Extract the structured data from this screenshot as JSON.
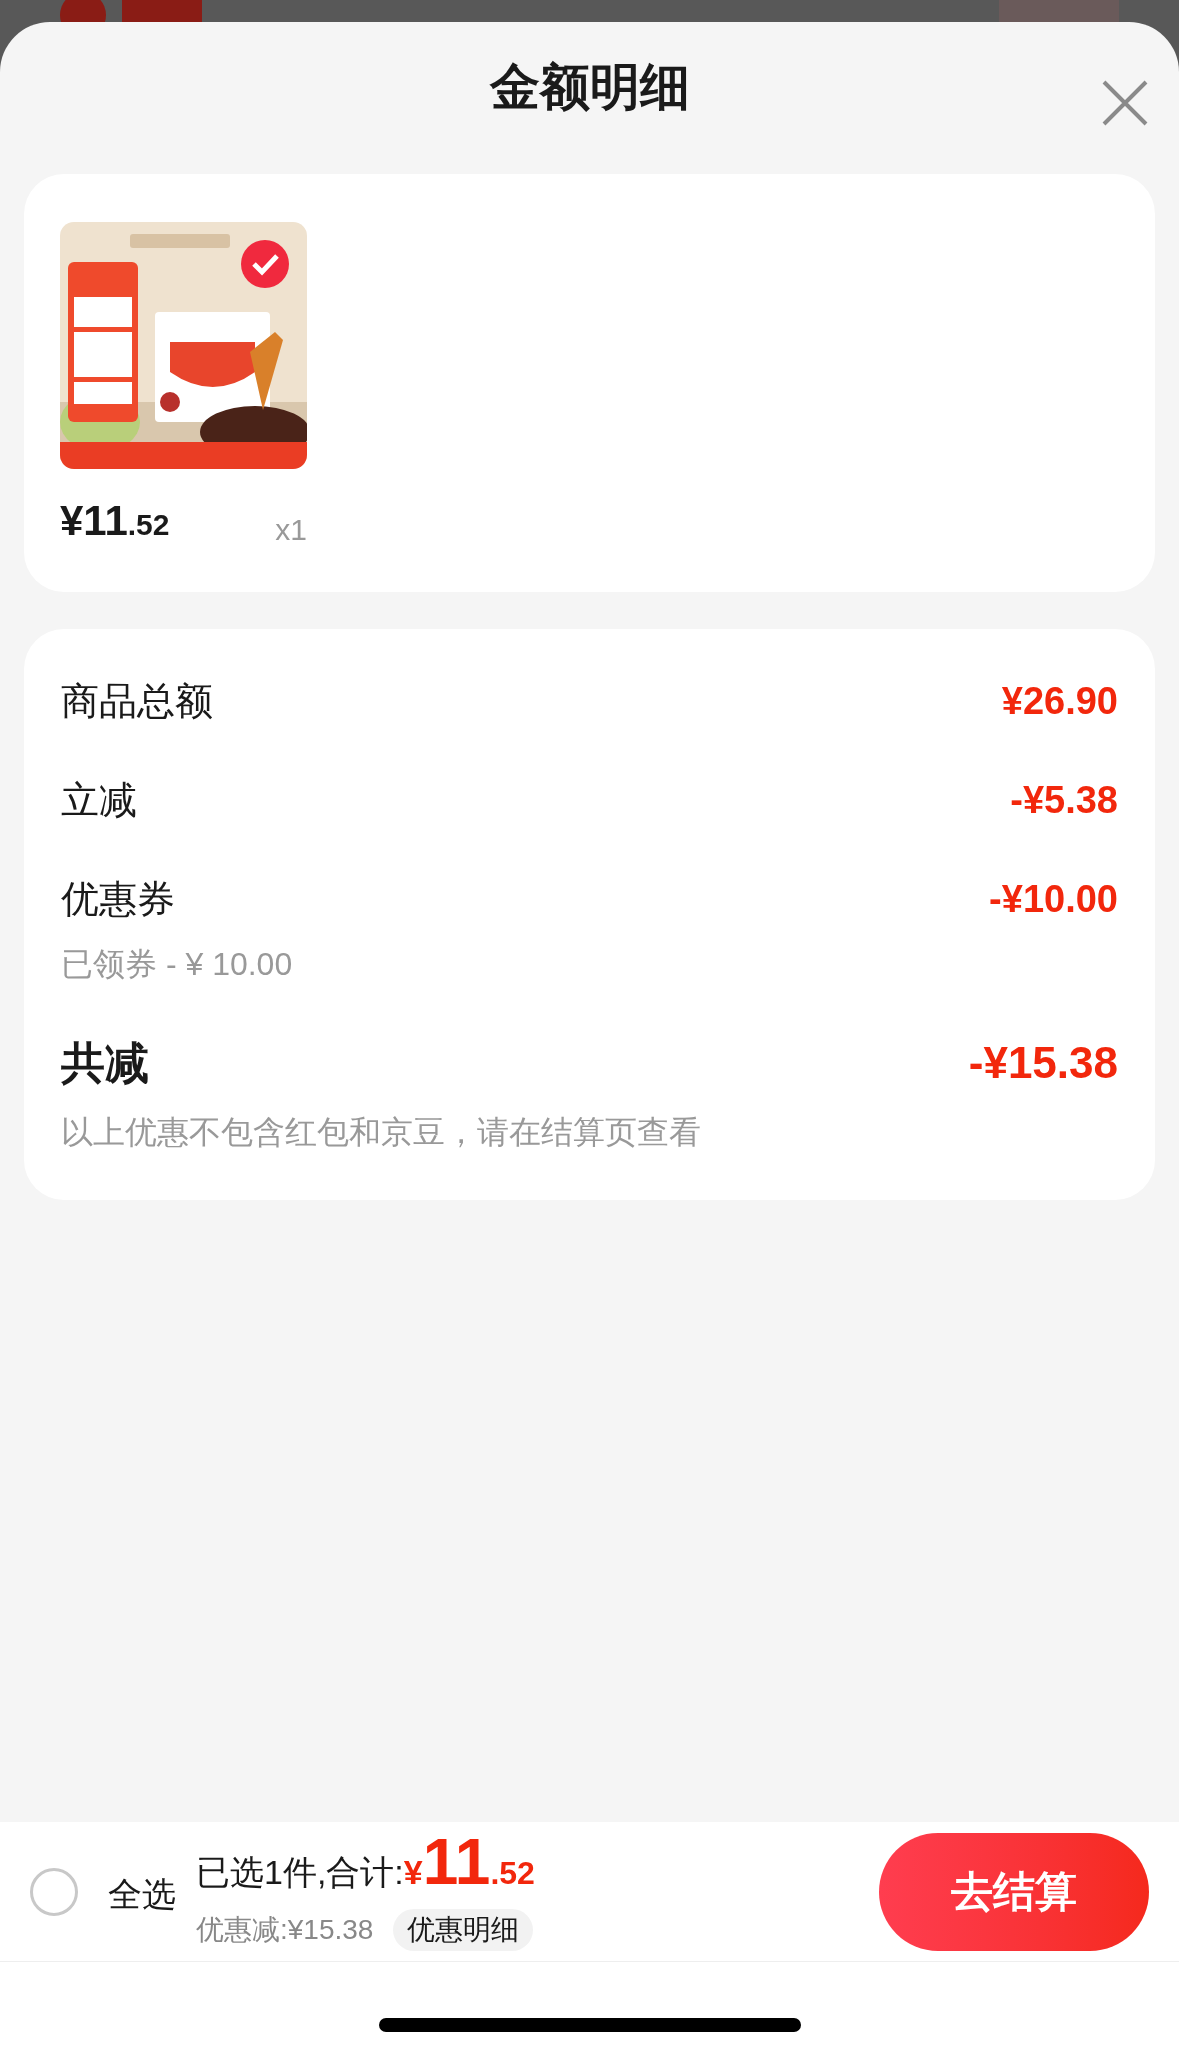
{
  "sheet": {
    "title": "金额明细"
  },
  "products": [
    {
      "kind": "picture",
      "selected": true,
      "price_symbol": "¥",
      "price_integer": "11",
      "price_decimal": ".52",
      "quantity": "x1"
    }
  ],
  "summary_rows": [
    {
      "kind": "normal",
      "label": "商品总额",
      "amount": "¥26.90"
    },
    {
      "kind": "normal",
      "label": "立减",
      "amount": "-¥5.38"
    },
    {
      "kind": "normal",
      "label": "优惠券",
      "amount": "-¥10.00",
      "note": "已领券 - ¥ 10.00"
    },
    {
      "kind": "total",
      "label": "共减",
      "amount": "-¥15.38",
      "note": "以上优惠不包含红包和京豆，请在结算页查看"
    }
  ],
  "bottom_bar": {
    "select_all": {
      "label": "全选",
      "checked": false
    },
    "selected_count": "已选1件,合计:",
    "total_symbol": "¥",
    "total_integer": "11",
    "total_decimal": ".52",
    "discount": "优惠减:¥15.38",
    "discount_detail_link": "优惠明细",
    "checkout_button": "去结算"
  }
}
